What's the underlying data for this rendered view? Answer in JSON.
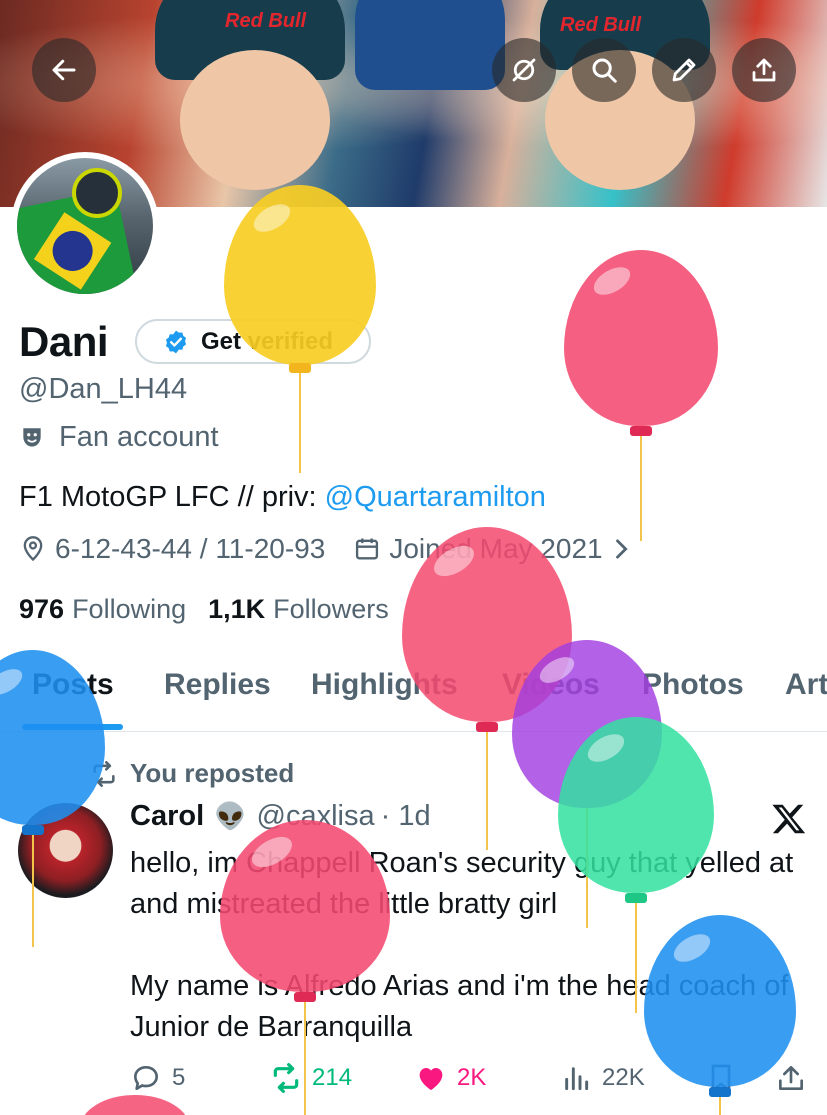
{
  "profile": {
    "name": "Dani",
    "verify_label": "Get verified",
    "handle": "@Dan_LH44",
    "category": "Fan account",
    "bio_text": "F1 MotoGP LFC // priv: ",
    "bio_mention": "@Quartaramilton",
    "location": "6-12-43-44 / 11-20-93",
    "joined": "Joined May 2021",
    "following_count": "976",
    "following_label": "Following",
    "followers_count": "1,1K",
    "followers_label": "Followers"
  },
  "banner": {
    "brand_text": "Red Bull"
  },
  "header_buttons": [
    "back-icon",
    "unfollow-topic-icon",
    "search-icon",
    "edit-icon",
    "share-icon"
  ],
  "tabs": [
    {
      "label": "Posts",
      "active": true
    },
    {
      "label": "Replies",
      "active": false
    },
    {
      "label": "Highlights",
      "active": false
    },
    {
      "label": "Videos",
      "active": false
    },
    {
      "label": "Photos",
      "active": false
    },
    {
      "label": "Art",
      "active": false
    }
  ],
  "tweet": {
    "repost_label": "You reposted",
    "author_name": "Carol",
    "author_emoji": "👽",
    "author_handle": "@caxlisa",
    "time": "· 1d",
    "text_line1": "hello, im Chappell Roan's security guy that yelled at and mistreated the little bratty girl",
    "text_line2": "My name is Alfredo Arias and i'm the head coach of Junior de Barranquilla",
    "replies": "5",
    "reposts": "214",
    "likes": "2K",
    "views": "22K"
  },
  "colors": {
    "accent": "#1d9bf0",
    "repost": "#00ba7c",
    "like": "#f91880",
    "muted": "#536471"
  }
}
